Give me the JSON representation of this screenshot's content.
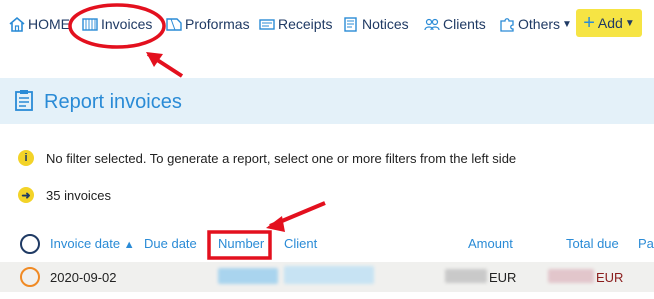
{
  "nav": {
    "home": "HOME",
    "invoices": "Invoices",
    "proformas": "Proformas",
    "receipts": "Receipts",
    "notices": "Notices",
    "clients": "Clients",
    "others": "Others",
    "add": "Add"
  },
  "header": {
    "title": "Report invoices"
  },
  "info": {
    "filter_msg": "No filter selected. To generate a report, select one or more filters from the left side",
    "count_msg": "35 invoices"
  },
  "table": {
    "columns": [
      "Invoice date",
      "Due date",
      "Number",
      "Client",
      "Amount",
      "Total due",
      "Pa"
    ],
    "rows": [
      {
        "invoice_date": "2020-09-02",
        "amount_currency": "EUR",
        "total_due_currency": "EUR"
      }
    ]
  },
  "colors": {
    "nav_text": "#1f3a64",
    "accent_blue": "#2a8bd6",
    "add_button": "#f6e444",
    "annotation_red": "#e3101e",
    "header_band": "#e4f1f9"
  },
  "icons": {
    "home": "home-icon",
    "invoices": "invoice-icon",
    "proformas": "proforma-icon",
    "receipts": "receipt-icon",
    "notices": "notice-icon",
    "clients": "clients-icon",
    "others": "puzzle-icon",
    "add": "plus-icon",
    "header": "clipboard-icon",
    "info": "info-icon",
    "arrow": "arrow-right-icon"
  }
}
